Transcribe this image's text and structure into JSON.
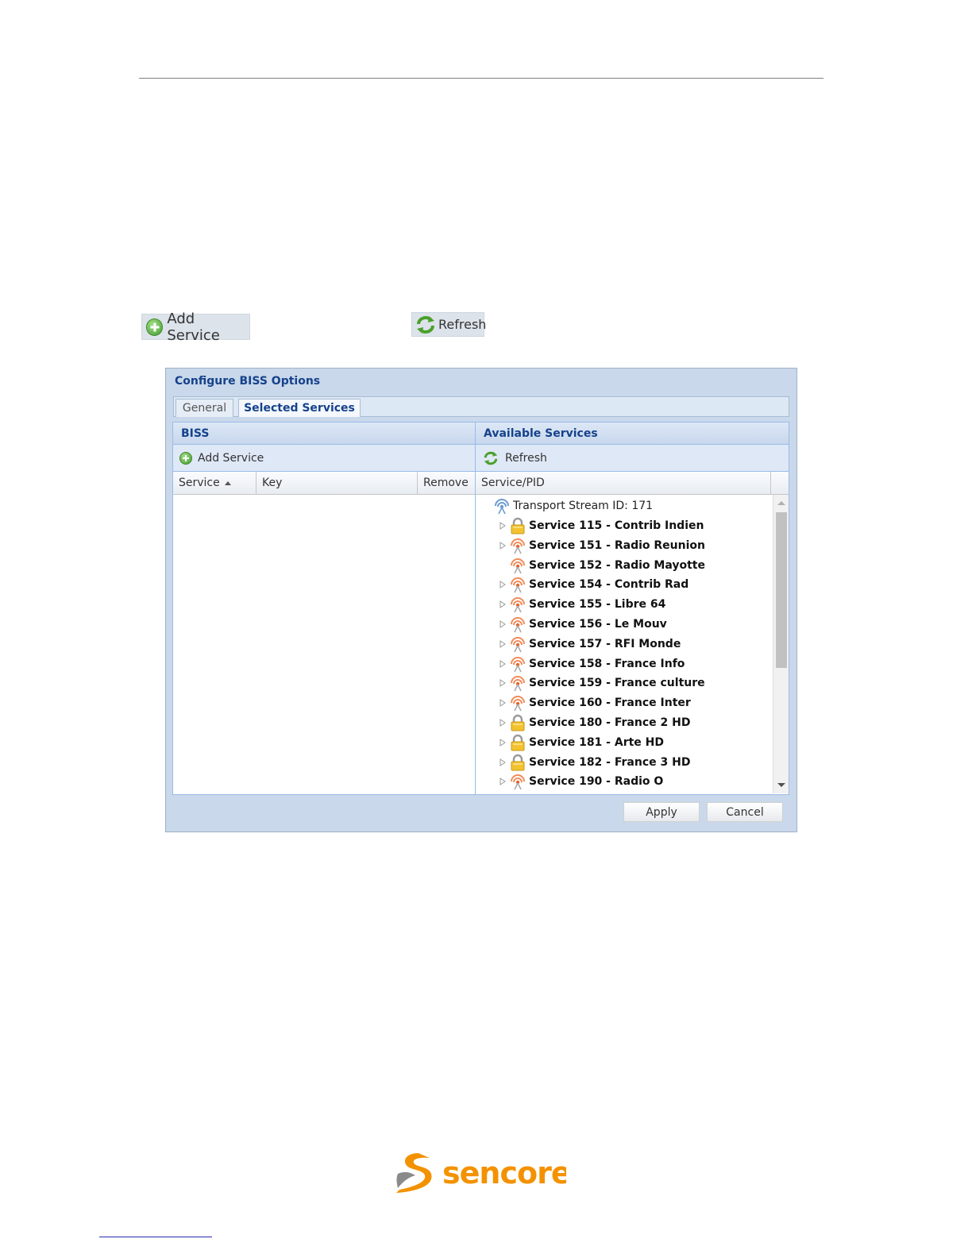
{
  "samples": {
    "add_service_label": "Add Service",
    "refresh_label": "Refresh"
  },
  "dialog": {
    "title": "Configure BISS Options",
    "tabs": [
      {
        "label": "General",
        "active": false
      },
      {
        "label": "Selected Services",
        "active": true
      }
    ],
    "left_panel": {
      "header": "BISS",
      "toolbar_button": "Add Service",
      "columns": [
        "Service",
        "Key",
        "Remove"
      ]
    },
    "right_panel": {
      "header": "Available Services",
      "toolbar_button": "Refresh",
      "column": "Service/PID",
      "root": "Transport Stream ID: 171",
      "services": [
        {
          "label": "Service 115 - Contrib Indien",
          "icon": "lock-icon",
          "expandable": true
        },
        {
          "label": "Service 151 - Radio Reunion",
          "icon": "broadcast-icon",
          "expandable": true
        },
        {
          "label": "Service 152 - Radio Mayotte",
          "icon": "broadcast-icon",
          "expandable": false
        },
        {
          "label": "Service 154 - Contrib Rad",
          "icon": "broadcast-icon",
          "expandable": true
        },
        {
          "label": "Service 155 - Libre 64",
          "icon": "broadcast-icon",
          "expandable": true
        },
        {
          "label": "Service 156 - Le Mouv",
          "icon": "broadcast-icon",
          "expandable": true
        },
        {
          "label": "Service 157 - RFI Monde",
          "icon": "broadcast-icon",
          "expandable": true
        },
        {
          "label": "Service 158 - France Info",
          "icon": "broadcast-icon",
          "expandable": true
        },
        {
          "label": "Service 159 - France culture",
          "icon": "broadcast-icon",
          "expandable": true
        },
        {
          "label": "Service 160 - France Inter",
          "icon": "broadcast-icon",
          "expandable": true
        },
        {
          "label": "Service 180 - France 2 HD",
          "icon": "lock-icon",
          "expandable": true
        },
        {
          "label": "Service 181 - Arte HD",
          "icon": "lock-icon",
          "expandable": true
        },
        {
          "label": "Service 182 - France 3 HD",
          "icon": "lock-icon",
          "expandable": true
        },
        {
          "label": "Service 190 - Radio O",
          "icon": "broadcast-icon",
          "expandable": true
        }
      ]
    },
    "buttons": {
      "apply": "Apply",
      "cancel": "Cancel"
    }
  },
  "logo": {
    "text": "sencore",
    "color": "#f39200"
  }
}
